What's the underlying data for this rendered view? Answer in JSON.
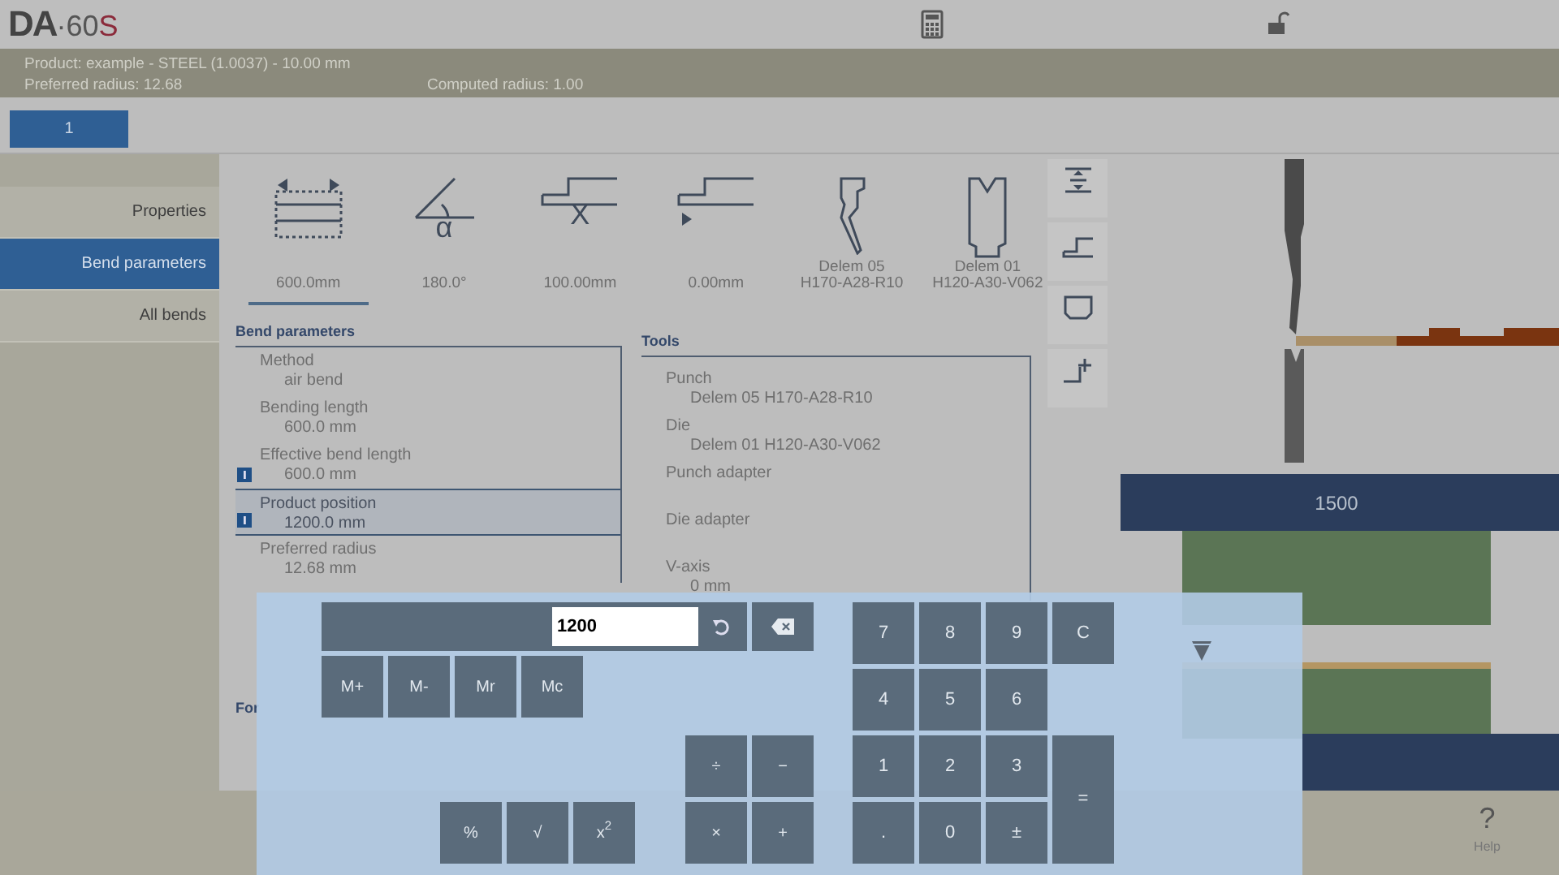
{
  "header": {
    "logo": {
      "brand": "DA",
      "model": "·60",
      "suffix": "S"
    }
  },
  "info_bar": {
    "product": "Product: example - STEEL (1.0037) - 10.00 mm",
    "preferred_radius": "Preferred radius: 12.68",
    "computed_radius": "Computed radius: 1.00"
  },
  "bend_tabs": [
    {
      "label": "1",
      "selected": true
    }
  ],
  "sidebar": {
    "items": [
      {
        "label": "Properties",
        "selected": false
      },
      {
        "label": "Bend parameters",
        "selected": true
      },
      {
        "label": "All bends",
        "selected": false
      }
    ]
  },
  "parameter_icons": [
    {
      "kind": "length",
      "lines": [
        "600.0mm"
      ],
      "selected": true
    },
    {
      "kind": "angle",
      "symbol": "α",
      "lines": [
        "180.0°"
      ],
      "selected": false
    },
    {
      "kind": "x-axis",
      "symbol": "X",
      "lines": [
        "100.00mm"
      ],
      "selected": false
    },
    {
      "kind": "r-axis",
      "lines": [
        "0.00mm"
      ],
      "selected": false
    },
    {
      "kind": "punch",
      "lines": [
        "Delem 05",
        "H170-A28-R10"
      ],
      "selected": false
    },
    {
      "kind": "die",
      "lines": [
        "Delem 01",
        "H120-A30-V062"
      ],
      "selected": false
    }
  ],
  "bend_parameters": {
    "title": "Bend parameters",
    "items": [
      {
        "label": "Method",
        "value": "air bend",
        "info": false,
        "selected": false
      },
      {
        "label": "Bending length",
        "value": "600.0 mm",
        "info": false,
        "selected": false
      },
      {
        "label": "Effective bend length",
        "value": "600.0 mm",
        "info": true,
        "selected": false
      },
      {
        "label": "Product position",
        "value": "1200.0 mm",
        "info": true,
        "selected": true
      },
      {
        "label": "Preferred radius",
        "value": "12.68 mm",
        "info": false,
        "selected": false
      }
    ]
  },
  "tools": {
    "title": "Tools",
    "items": [
      {
        "label": "Punch",
        "value": "Delem 05 H170-A28-R10"
      },
      {
        "label": "Die",
        "value": "Delem 01 H120-A30-V062"
      },
      {
        "label": "Punch adapter"
      },
      {
        "label": "Die adapter"
      },
      {
        "label": "V-axis",
        "value": "0 mm"
      }
    ]
  },
  "lower_section": {
    "title": "For"
  },
  "side_toolbar": [
    {
      "kind": "distance"
    },
    {
      "kind": "step"
    },
    {
      "kind": "frame"
    },
    {
      "kind": "add-step"
    }
  ],
  "machine_view": {
    "bar_label": "1500"
  },
  "footer": {
    "help": {
      "symbol": "?",
      "label": "Help"
    }
  },
  "calculator": {
    "display": "1200",
    "memory_keys": [
      "M+",
      "M-",
      "Mr",
      "Mc"
    ],
    "operator_keys": [
      "÷",
      "−",
      "×",
      "+"
    ],
    "function_keys": [
      "%",
      "√",
      "x$^{2}$"
    ],
    "keypad": [
      [
        {
          "label": "7",
          "kind": "digit"
        },
        {
          "label": "8",
          "kind": "digit"
        },
        {
          "label": "9",
          "kind": "digit"
        },
        {
          "label": "C",
          "kind": "clear"
        }
      ],
      [
        {
          "label": "4",
          "kind": "digit"
        },
        {
          "label": "5",
          "kind": "digit"
        },
        {
          "label": "6",
          "kind": "digit"
        }
      ],
      [
        {
          "label": "1",
          "kind": "digit"
        },
        {
          "label": "2",
          "kind": "digit"
        },
        {
          "label": "3",
          "kind": "digit"
        },
        {
          "label": "=",
          "kind": "equals"
        }
      ],
      [
        {
          "label": ".",
          "kind": "digit"
        },
        {
          "label": "0",
          "kind": "digit"
        },
        {
          "label": "±",
          "kind": "digit"
        }
      ]
    ]
  }
}
